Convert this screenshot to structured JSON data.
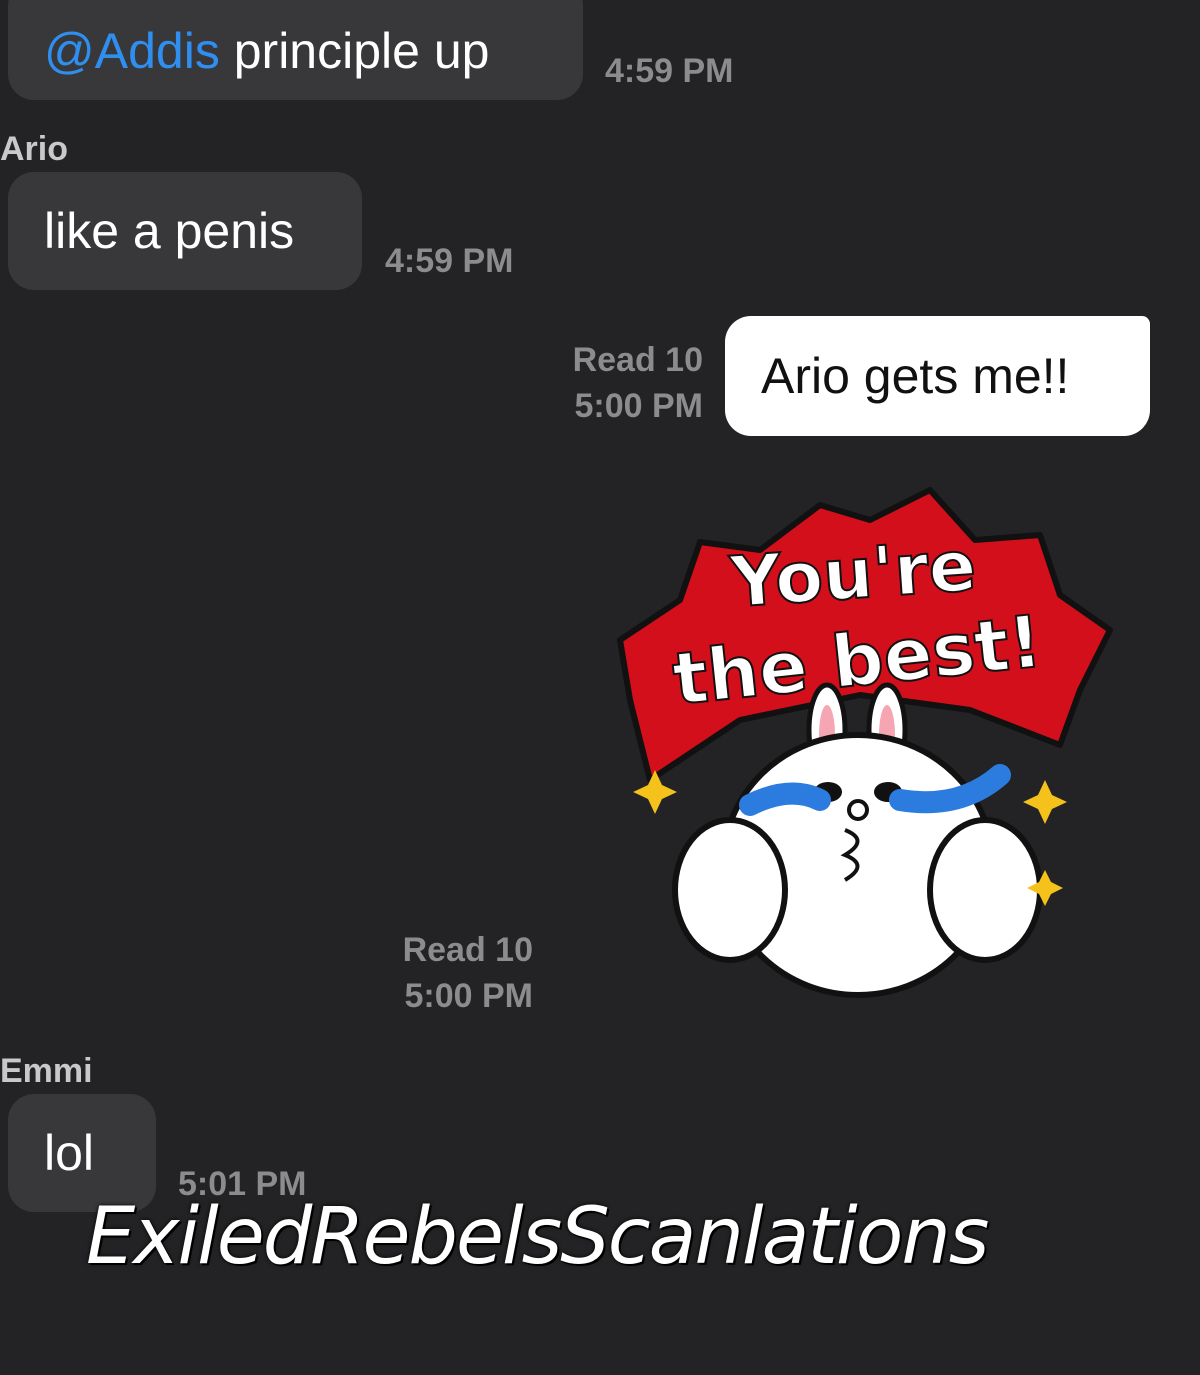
{
  "messages": [
    {
      "mention": "@Addis",
      "text": " principle up",
      "time": "4:59 PM"
    },
    {
      "sender": "Ario",
      "text": "like a penis",
      "time": "4:59 PM"
    },
    {
      "receipt_read": "Read 10",
      "receipt_time": "5:00 PM",
      "text": "Ario gets me!!"
    },
    {
      "sticker_line1": "You're",
      "sticker_line2": "the best!",
      "receipt_read": "Read 10",
      "receipt_time": "5:00 PM"
    },
    {
      "sender": "Emmi",
      "text": "lol",
      "time": "5:01 PM"
    }
  ],
  "watermark": "ExiledRebelsScanlations",
  "colors": {
    "background": "#232325",
    "incoming_bubble": "#38383b",
    "outgoing_bubble": "#ffffff",
    "mention": "#2f8ff0",
    "sticker_red": "#d20f1a"
  }
}
